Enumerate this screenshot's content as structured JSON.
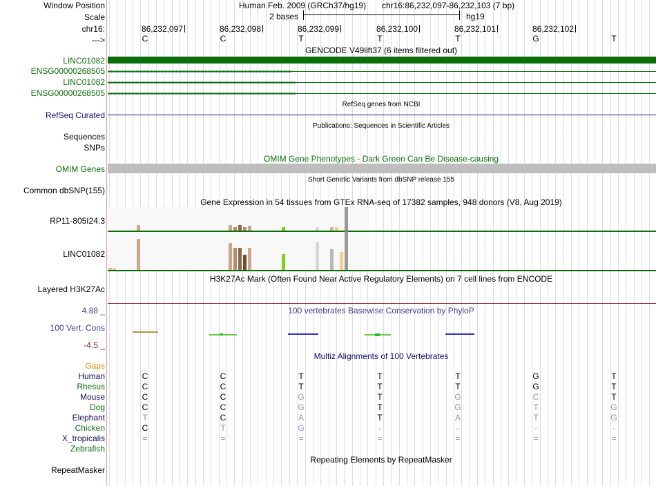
{
  "header": {
    "window_position_label": "Window Position",
    "scale_label": "Scale",
    "chrom_label": "chr16:",
    "strand_label": "--->",
    "assembly": "Human Feb. 2009 (GRCh37/hg19)",
    "position": "chr16:86,232,097-86,232,103 (7 bp)",
    "scale_text": "2 bases",
    "scale_db": "hg19",
    "coords": [
      "86,232,097",
      "86,232,098",
      "86,232,099",
      "86,232,100",
      "86,232,101",
      "86,232,102"
    ],
    "bases": [
      "C",
      "C",
      "T",
      "T",
      "T",
      "G",
      "T"
    ]
  },
  "gencode": {
    "title": "GENCODE V49lift37 (6 items filtered out)",
    "rows": [
      "LINC01082",
      "ENSG00000268505",
      "LINC01082",
      "ENSG00000268505"
    ],
    "left_chevrons": "‹‹‹‹‹‹‹‹‹‹‹‹‹‹‹‹‹‹‹‹‹‹‹‹‹‹‹‹‹‹‹‹‹‹‹‹‹‹‹‹‹‹‹‹‹‹‹‹‹‹‹‹‹‹‹‹‹‹‹‹‹‹‹‹‹‹‹‹‹‹‹‹‹‹‹‹‹‹‹‹‹‹‹‹‹‹‹‹‹‹‹‹‹‹‹‹‹‹‹‹‹‹‹‹‹‹‹‹‹‹‹‹‹‹‹‹‹‹‹‹‹‹‹‹‹‹‹‹‹‹‹‹‹",
    "right_chevrons": "››››››››››››››››››››››››››››››››››››››››››››››››››››››››››››››››››››››››››››››››››››››››››››››››››››››››››››››››››››››››››››››››››››››››"
  },
  "refseq": {
    "label": "RefSeq Curated",
    "title": "RefSeq genes from NCBI"
  },
  "publications": {
    "title": "Publications: Sequences in Scientific Articles",
    "label1": "Sequences",
    "label2": "SNPs"
  },
  "omim": {
    "title": "OMIM Gene Phenotypes - Dark Green Can Be Disease-causing",
    "label": "OMIM Genes"
  },
  "dbsnp": {
    "title": "Short Genetic Variants from dbSNP release 155",
    "label": "Common dbSNP(155)"
  },
  "gtex": {
    "title": "Gene Expression in 54 tissues from GTEx RNA-seq of 17382 samples, 948 donors (V8, Aug 2019)",
    "genes": [
      "RP11-805I24.3",
      "LINC01082"
    ]
  },
  "h3k27ac": {
    "title": "H3K27Ac Mark (Often Found Near Active Regulatory Elements) on 7 cell lines from ENCODE",
    "label": "Layered H3K27Ac"
  },
  "phylop": {
    "title": "100 vertebrates Basewise Conservation by PhyloP",
    "label": "100 Vert. Cons",
    "max_label": "4.88 _",
    "min_label": "-4.5 _"
  },
  "multiz": {
    "title": "Multiz Alignments of 100 Vertebrates",
    "gaps_label": "Gaps",
    "species": [
      "Human",
      "Rhesus",
      "Mouse",
      "Dog",
      "Elephant",
      "Chicken",
      "X_tropicalis",
      "Zebrafish"
    ],
    "rows": [
      [
        "C",
        "C",
        "T",
        "T",
        "T",
        "G",
        "T"
      ],
      [
        "C",
        "C",
        "T",
        "T",
        "T",
        "G",
        "T"
      ],
      [
        "C",
        "C",
        "G",
        "T",
        "G",
        "C",
        "T"
      ],
      [
        "C",
        "C",
        "G",
        "T",
        "G",
        "T",
        "G"
      ],
      [
        "T",
        "C",
        "A",
        "T",
        "A",
        "T",
        "G"
      ],
      [
        "C",
        "T",
        "G",
        "-",
        "-",
        "-",
        "-"
      ],
      [
        "=",
        "=",
        "=",
        "=",
        "=",
        "=",
        "="
      ],
      [
        "",
        "",
        "",
        "",
        "",
        "",
        ""
      ]
    ],
    "dim": [
      [
        0,
        0,
        0,
        0,
        0,
        0,
        0
      ],
      [
        0,
        0,
        0,
        0,
        0,
        0,
        0
      ],
      [
        0,
        0,
        1,
        0,
        1,
        1,
        0
      ],
      [
        0,
        0,
        1,
        0,
        1,
        1,
        1
      ],
      [
        1,
        0,
        1,
        0,
        1,
        1,
        1
      ],
      [
        0,
        1,
        1,
        1,
        1,
        1,
        1
      ],
      [
        1,
        1,
        1,
        1,
        1,
        1,
        1
      ],
      [
        0,
        0,
        0,
        0,
        0,
        0,
        0
      ]
    ]
  },
  "repeatmasker": {
    "title": "Repeating Elements by RepeatMasker",
    "label": "RepeatMasker"
  },
  "colors": {
    "gencode_green": "#0b6e0b",
    "refseq_blue": "#10106e",
    "omim_green": "#0b6e0b",
    "omim_bar": "#bebebe",
    "phylop_blue": "#3f3f8f",
    "phylop_red": "#8f2020",
    "gaps_orange": "#d9920a",
    "species_navy": "#101060",
    "species_green": "#0b6e0b"
  }
}
